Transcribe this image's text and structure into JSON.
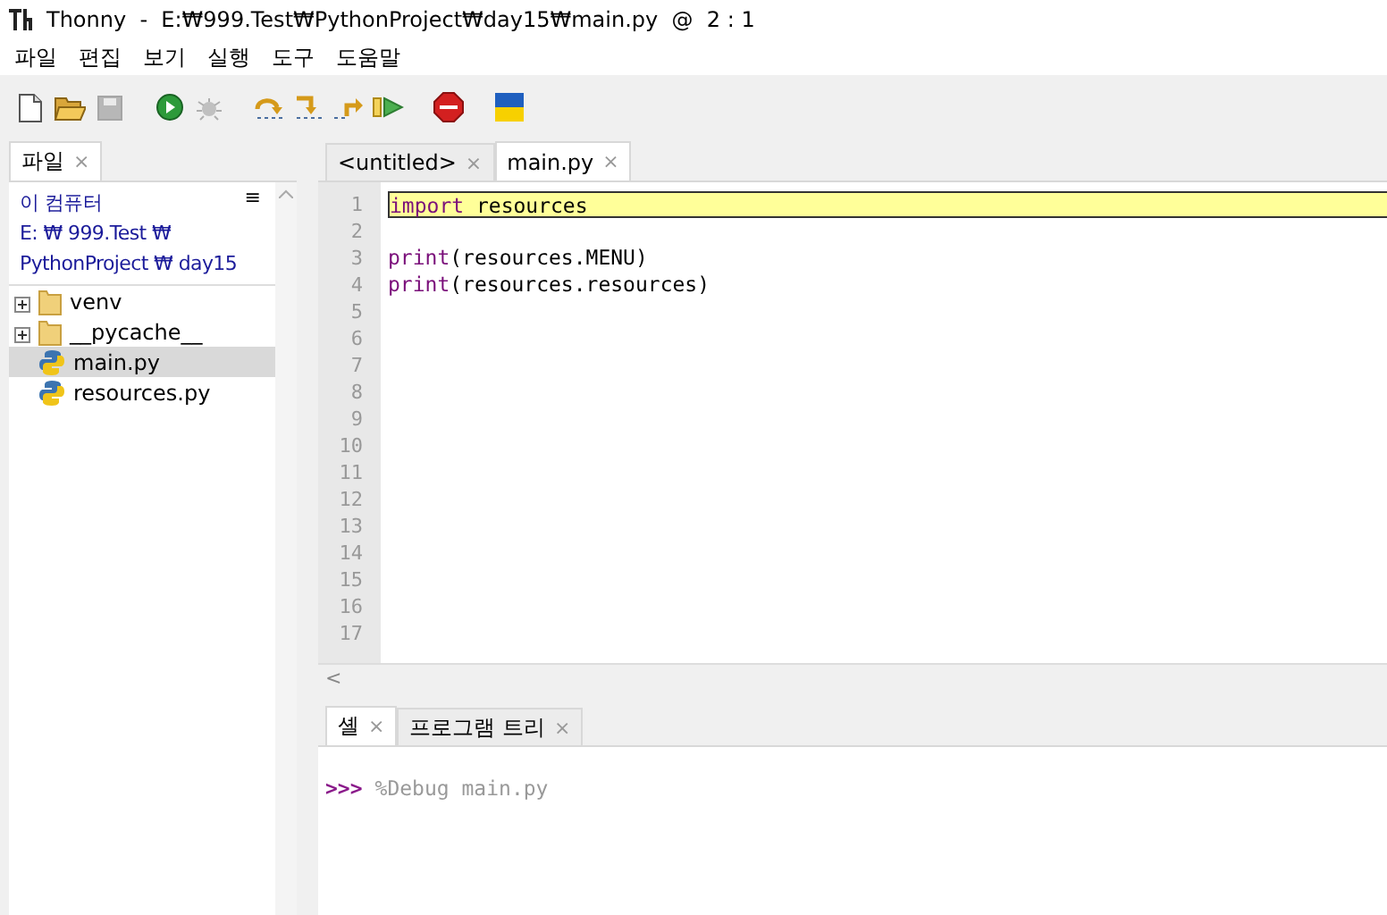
{
  "window": {
    "title": "Thonny  -  E:₩999.Test₩PythonProject₩day15₩main.py  @  2 : 1"
  },
  "menu": [
    "파일",
    "편집",
    "보기",
    "실행",
    "도구",
    "도움말"
  ],
  "toolbar": [
    {
      "kind": "new",
      "disabled": false
    },
    {
      "kind": "open",
      "disabled": false
    },
    {
      "kind": "save",
      "disabled": true
    },
    {
      "kind": "sep"
    },
    {
      "kind": "run",
      "disabled": false
    },
    {
      "kind": "debug",
      "disabled": true
    },
    {
      "kind": "sep"
    },
    {
      "kind": "step-over",
      "disabled": false
    },
    {
      "kind": "step-into",
      "disabled": false
    },
    {
      "kind": "step-out",
      "disabled": false
    },
    {
      "kind": "resume",
      "disabled": false
    },
    {
      "kind": "sep"
    },
    {
      "kind": "stop",
      "disabled": false
    },
    {
      "kind": "sep"
    },
    {
      "kind": "flag",
      "disabled": false
    }
  ],
  "files_panel": {
    "tab": {
      "label": "파일",
      "close": "×",
      "selected": true
    },
    "path": [
      "이 컴퓨터",
      "E: ₩ 999.Test ₩",
      "PythonProject ₩ day15"
    ],
    "menu_glyph": "≡",
    "tree": [
      {
        "name": "venv",
        "kind": "folder",
        "expanded": false,
        "selected": false
      },
      {
        "name": "__pycache__",
        "kind": "folder",
        "expanded": false,
        "selected": false
      },
      {
        "name": "main.py",
        "kind": "python",
        "selected": true
      },
      {
        "name": "resources.py",
        "kind": "python",
        "selected": false
      }
    ]
  },
  "editor": {
    "tabs": [
      {
        "label": "<untitled>",
        "close": "×",
        "selected": false
      },
      {
        "label": "main.py",
        "close": "×",
        "selected": true
      }
    ],
    "lines": [
      {
        "number": "1",
        "current": true,
        "tokens": [
          {
            "kind": "keyword",
            "text": "import"
          },
          {
            "kind": "plain",
            "text": " resources"
          }
        ]
      },
      {
        "number": "2",
        "current": false
      },
      {
        "number": "3",
        "current": false,
        "tokens": [
          {
            "kind": "builtin",
            "text": "print"
          },
          {
            "kind": "plain",
            "text": "(resources.MENU)"
          }
        ]
      },
      {
        "number": "4",
        "current": false,
        "tokens": [
          {
            "kind": "builtin",
            "text": "print"
          },
          {
            "kind": "plain",
            "text": "(resources.resources)"
          }
        ]
      },
      {
        "number": "5",
        "current": false
      },
      {
        "number": "6",
        "current": false
      },
      {
        "number": "7",
        "current": false
      },
      {
        "number": "8",
        "current": false
      },
      {
        "number": "9",
        "current": false
      },
      {
        "number": "10",
        "current": false
      },
      {
        "number": "11",
        "current": false
      },
      {
        "number": "12",
        "current": false
      },
      {
        "number": "13",
        "current": false
      },
      {
        "number": "14",
        "current": false
      },
      {
        "number": "15",
        "current": false
      },
      {
        "number": "16",
        "current": false
      },
      {
        "number": "17",
        "current": false
      }
    ],
    "hscroll_glyph": "<"
  },
  "shell": {
    "tabs": [
      {
        "label": "셸",
        "close": "×",
        "selected": true
      },
      {
        "label": "프로그램 트리",
        "close": "×",
        "selected": false
      }
    ],
    "prompt": ">>>",
    "command": "%Debug main.py"
  }
}
